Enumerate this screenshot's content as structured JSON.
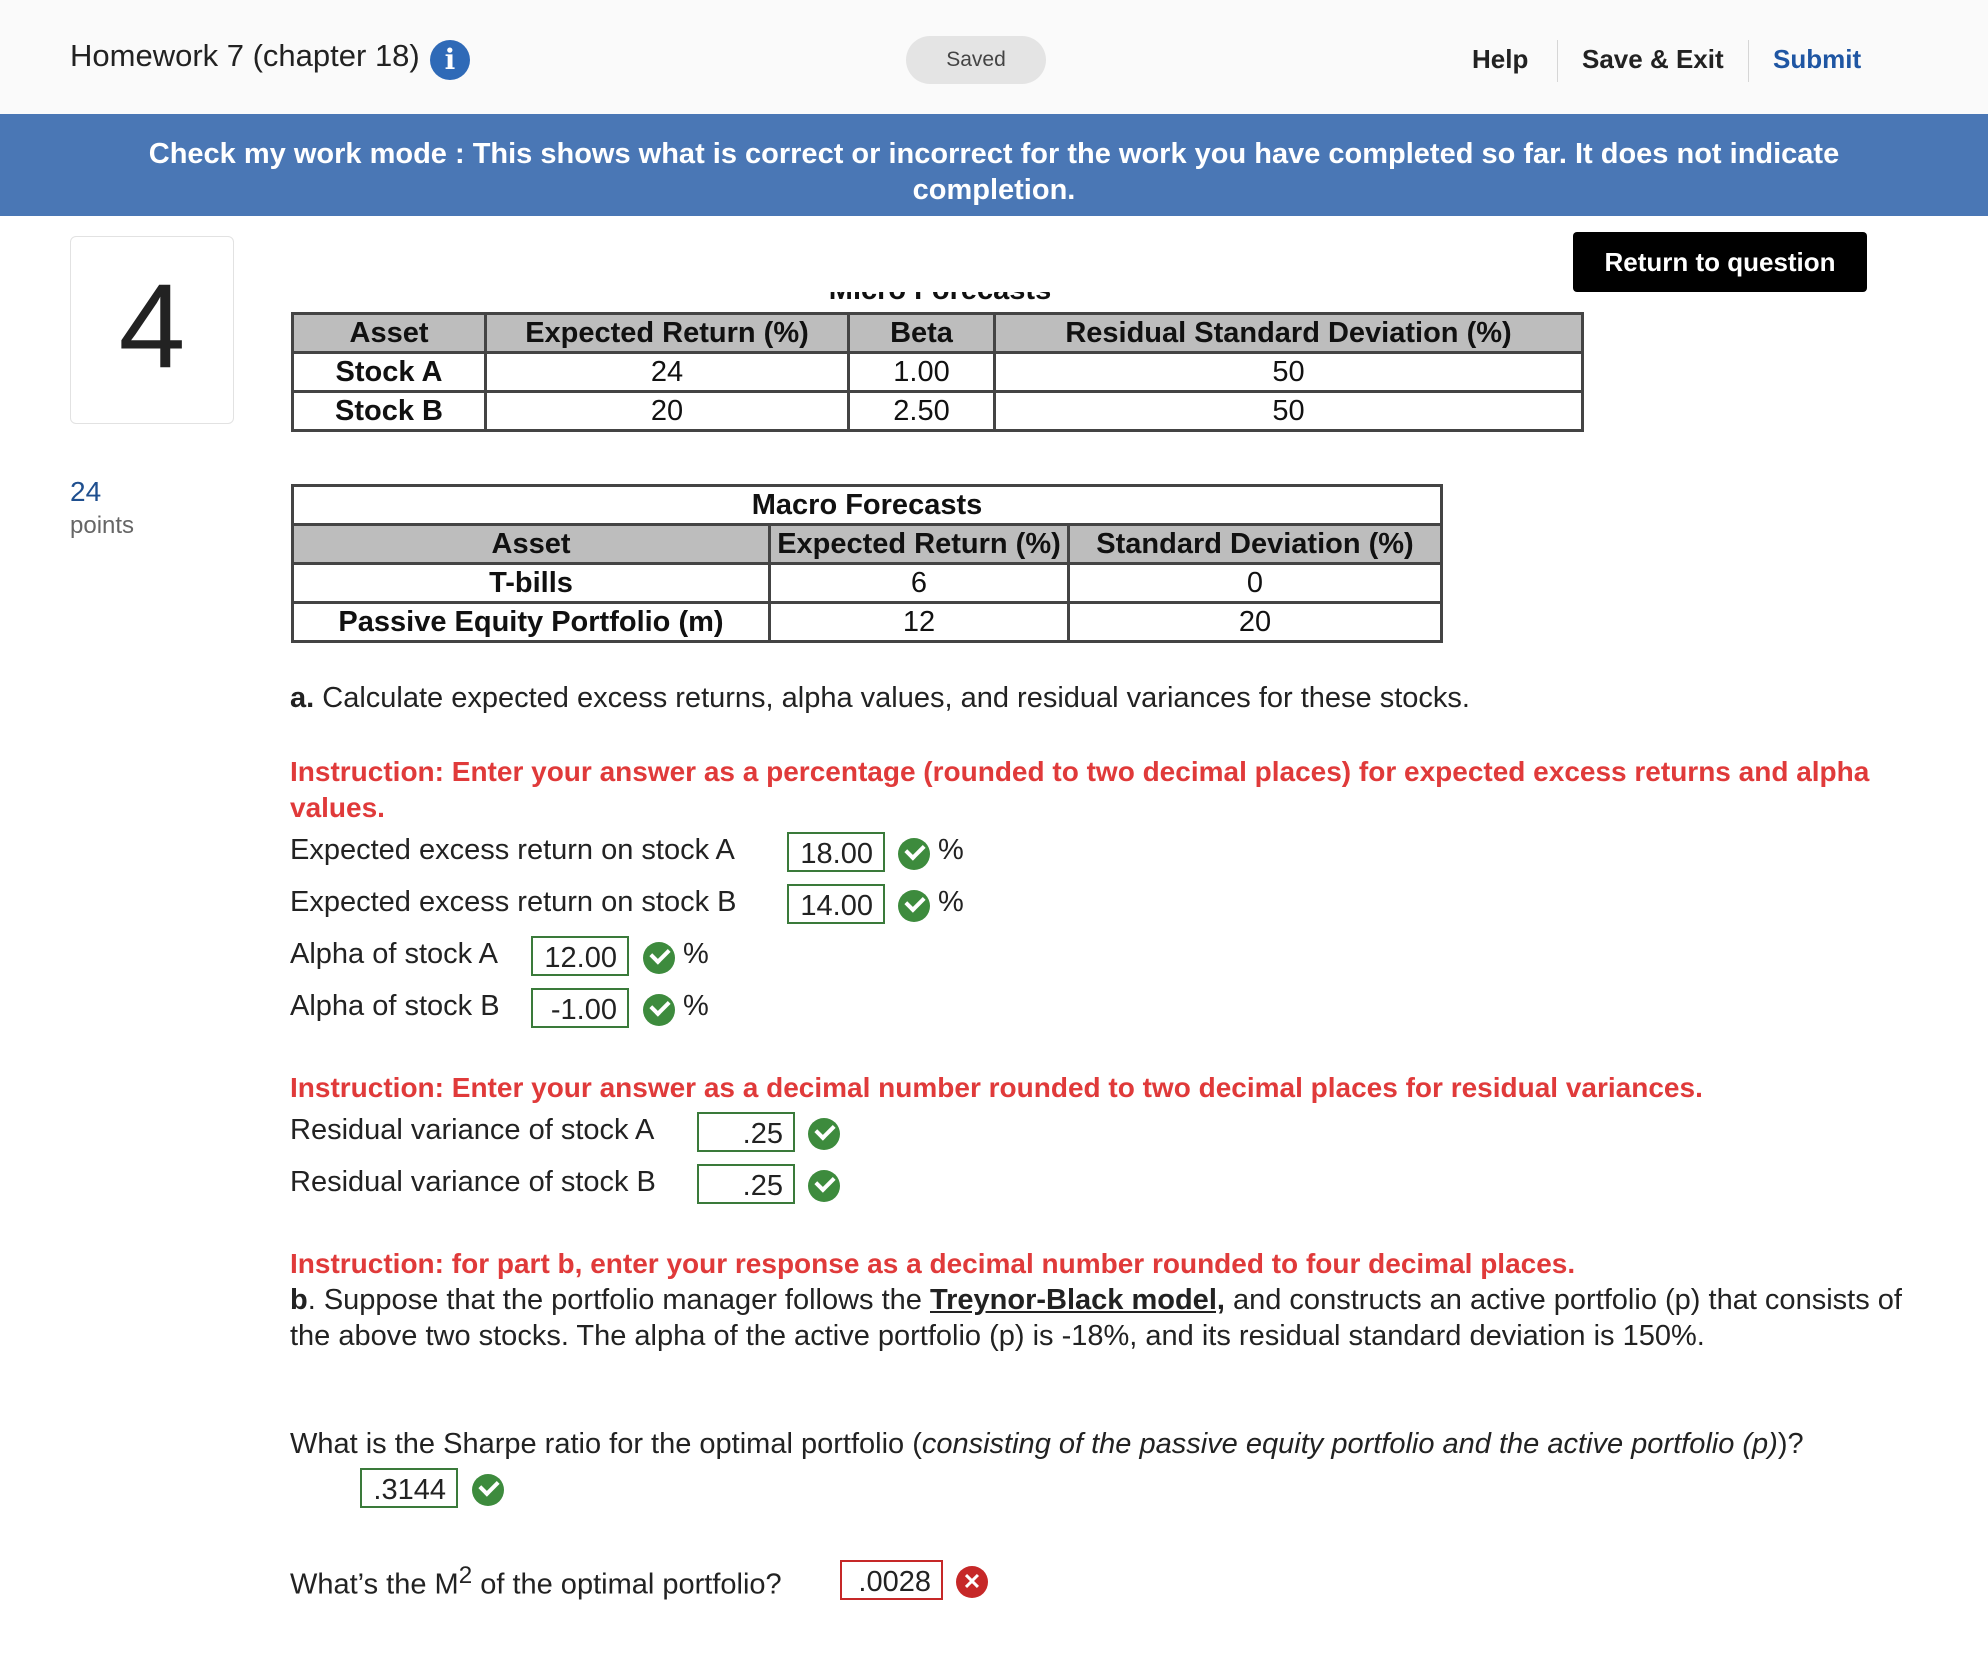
{
  "header": {
    "title": "Homework 7 (chapter 18)",
    "info_icon": "info-icon",
    "saved_label": "Saved",
    "help": "Help",
    "save_exit": "Save & Exit",
    "submit": "Submit"
  },
  "banner": {
    "text": "Check my work mode : This shows what is correct or incorrect for the work you have completed so far. It does not indicate completion."
  },
  "question": {
    "number": "4",
    "points_value": "24",
    "points_label": "points",
    "return_button": "Return to question"
  },
  "micro_table": {
    "caption": "Micro Forecasts",
    "headers": [
      "Asset",
      "Expected Return (%)",
      "Beta",
      "Residual Standard Deviation (%)"
    ],
    "rows": [
      [
        "Stock A",
        "24",
        "1.00",
        "50"
      ],
      [
        "Stock B",
        "20",
        "2.50",
        "50"
      ]
    ]
  },
  "macro_table": {
    "caption": "Macro Forecasts",
    "headers": [
      "Asset",
      "Expected Return (%)",
      "Standard Deviation (%)"
    ],
    "rows": [
      [
        "T-bills",
        "6",
        "0"
      ],
      [
        "Passive Equity Portfolio (m)",
        "12",
        "20"
      ]
    ]
  },
  "part_a": {
    "label": "a.",
    "prompt": "Calculate expected excess returns, alpha values, and residual variances for these stocks.",
    "instruction1": "Instruction: Enter your answer as a percentage (rounded to two decimal places) for expected excess returns and alpha values.",
    "fields1": [
      {
        "label": "Expected excess return on stock A",
        "value": "18.00",
        "unit": "%",
        "status": "correct"
      },
      {
        "label": "Expected excess return on stock B",
        "value": "14.00",
        "unit": "%",
        "status": "correct"
      },
      {
        "label": "Alpha of stock A",
        "value": "12.00",
        "unit": "%",
        "status": "correct"
      },
      {
        "label": "Alpha of stock B",
        "value": "-1.00",
        "unit": "%",
        "status": "correct"
      }
    ],
    "instruction2": "Instruction: Enter your answer as a decimal number rounded to two decimal places for residual variances.",
    "fields2": [
      {
        "label": "Residual variance of stock A",
        "value": ".25",
        "status": "correct"
      },
      {
        "label": "Residual variance of stock B",
        "value": ".25",
        "status": "correct"
      }
    ]
  },
  "part_b": {
    "instruction": "Instruction: for part b, enter your response as a decimal number rounded to four decimal places.",
    "label": "b",
    "text_pre": ". Suppose that the portfolio manager follows the ",
    "link": "Treynor-Black model,",
    "text_post": " and constructs an active portfolio (p) that consists of the above two stocks. The alpha of the active portfolio (p) is -18%, and its residual standard deviation is 150%.",
    "sharpe_q_pre": "What is the Sharpe ratio for the optimal portfolio (",
    "sharpe_q_italic": "consisting of the passive equity portfolio and the active portfolio (p)",
    "sharpe_q_post": ")?",
    "sharpe_value": ".3144",
    "sharpe_status": "correct",
    "m2_q_pre": "What’s the M",
    "m2_q_sup": "2",
    "m2_q_post": " of the optimal portfolio?",
    "m2_value": ".0028",
    "m2_status": "incorrect"
  },
  "colors": {
    "banner": "#4a77b5",
    "instruction": "#e03a3a",
    "correct": "#3d8b3d",
    "incorrect": "#c62828",
    "link": "#1f56a3"
  }
}
